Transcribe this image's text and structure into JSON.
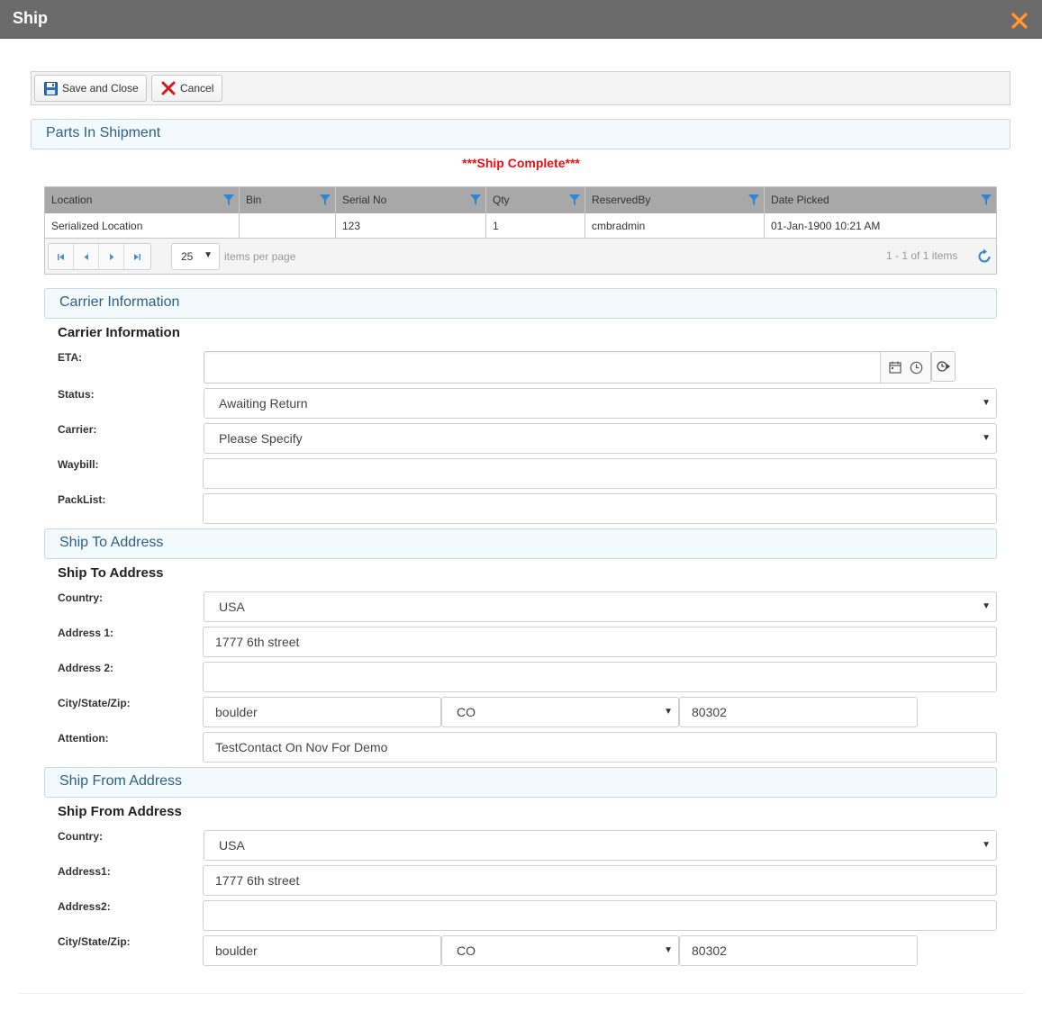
{
  "window": {
    "title": "Ship"
  },
  "toolbar": {
    "save_close": "Save and Close",
    "cancel": "Cancel"
  },
  "parts": {
    "section_title": "Parts In Shipment",
    "status_banner": "***Ship Complete***",
    "columns": [
      "Location",
      "Bin",
      "Serial No",
      "Qty",
      "ReservedBy",
      "Date Picked"
    ],
    "rows": [
      [
        "Serialized Location",
        "",
        "123",
        "1",
        "cmbradmin",
        "01-Jan-1900 10:21 AM"
      ]
    ],
    "page_size": "25",
    "items_per_page_label": "items per page",
    "pager_info": "1 - 1 of 1 items"
  },
  "carrier": {
    "section_title": "Carrier Information",
    "subheading": "Carrier Information",
    "eta_label": "ETA:",
    "eta_value": "",
    "status_label": "Status:",
    "status_value": "Awaiting Return",
    "carrier_label": "Carrier:",
    "carrier_value": "Please Specify",
    "waybill_label": "Waybill:",
    "waybill_value": "",
    "packlist_label": "PackList:",
    "packlist_value": ""
  },
  "ship_to": {
    "section_title": "Ship To Address",
    "subheading": "Ship To Address",
    "country_label": "Country:",
    "country_value": "USA",
    "address1_label": "Address 1:",
    "address1_value": "1777 6th street",
    "address2_label": "Address 2:",
    "address2_value": "",
    "city_label": "City/State/Zip:",
    "city_value": "boulder",
    "state_value": "CO",
    "zip_value": "80302",
    "attention_label": "Attention:",
    "attention_value": "TestContact  On Nov For Demo"
  },
  "ship_from": {
    "section_title": "Ship From Address",
    "subheading": "Ship From Address",
    "country_label": "Country:",
    "country_value": "USA",
    "address1_label": "Address1:",
    "address1_value": "1777 6th street",
    "address2_label": "Address2:",
    "address2_value": "",
    "city_label": "City/State/Zip:",
    "city_value": "boulder",
    "state_value": "CO",
    "zip_value": "80302"
  },
  "colors": {
    "titlebar": "#6b6b6b",
    "banner_red": "#e01414",
    "section_text": "#2f5f85",
    "accent_blue": "#4a8fd0"
  }
}
